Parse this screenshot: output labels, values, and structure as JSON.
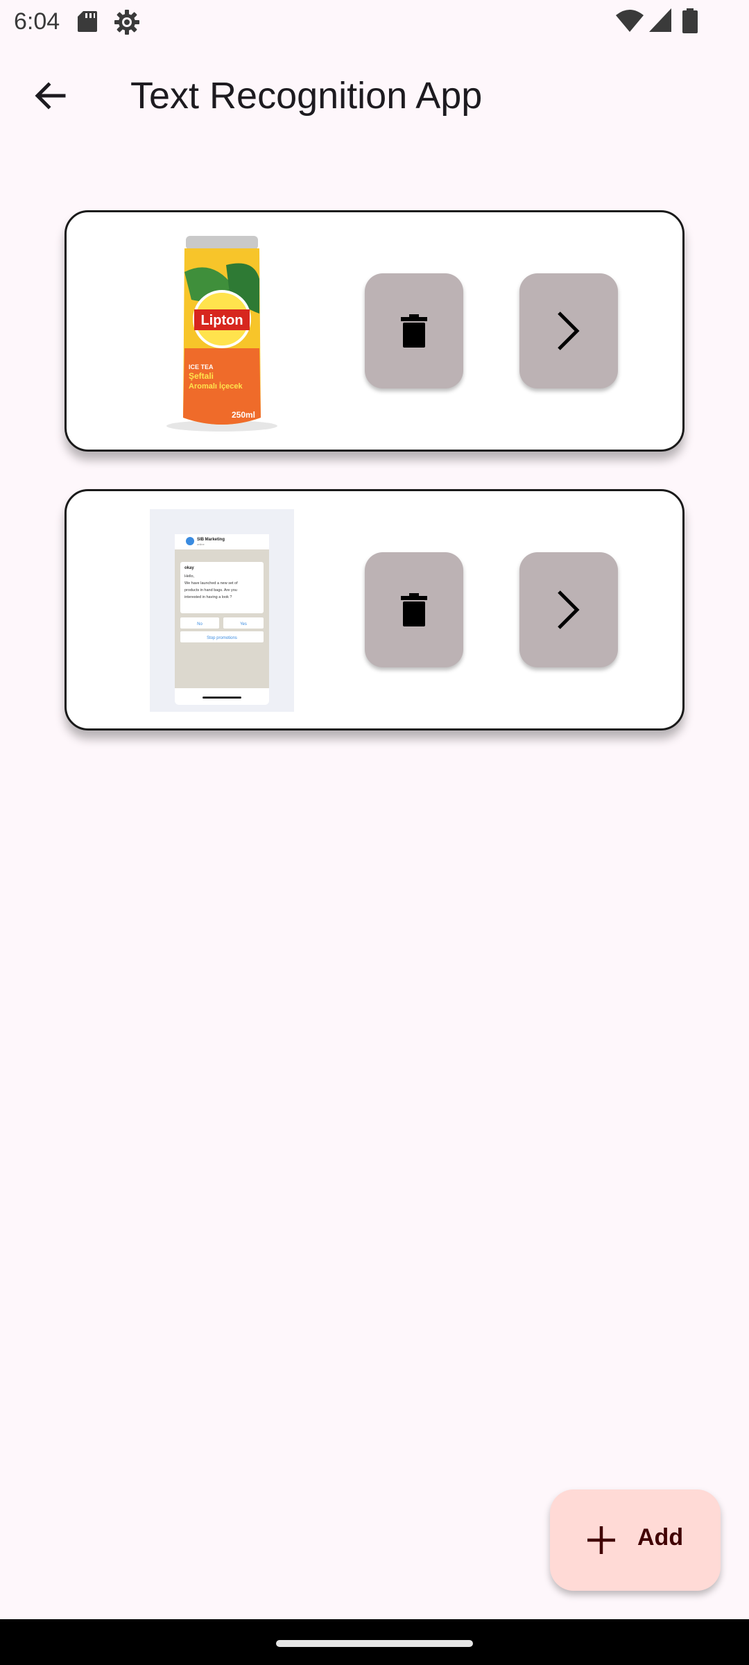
{
  "status_bar": {
    "time": "6:04",
    "icons": [
      "sd-card-icon",
      "gear-icon",
      "wifi-icon",
      "signal-icon",
      "battery-icon"
    ]
  },
  "app_bar": {
    "title": "Text Recognition App",
    "back_icon": "arrow-left-icon"
  },
  "cards": [
    {
      "thumbnail": "lipton-can-image",
      "thumbnail_text": {
        "brand": "Lipton",
        "line1": "ICE TEA",
        "line2": "Şeftali",
        "line3": "Aromalı İçecek",
        "volume": "250ml"
      },
      "delete_icon": "trash-icon",
      "open_icon": "chevron-right-icon"
    },
    {
      "thumbnail": "chat-screenshot-image",
      "thumbnail_text": {
        "contact": "SIB Marketing",
        "status": "online",
        "msg_title": "okay",
        "msg_line1": "Hello,",
        "msg_line2": "We have launched a new set of",
        "msg_line3": "products in hand bags. Are you",
        "msg_line4": "interested in having a look ?",
        "btn_no": "No",
        "btn_yes": "Yes",
        "btn_stop": "Stop promotions"
      },
      "delete_icon": "trash-icon",
      "open_icon": "chevron-right-icon"
    }
  ],
  "fab": {
    "label": "Add",
    "icon": "plus-icon"
  },
  "colors": {
    "background": "#fef7fb",
    "action_button": "#bcb2b4",
    "fab_background": "#ffdad6",
    "fab_text": "#410002"
  }
}
